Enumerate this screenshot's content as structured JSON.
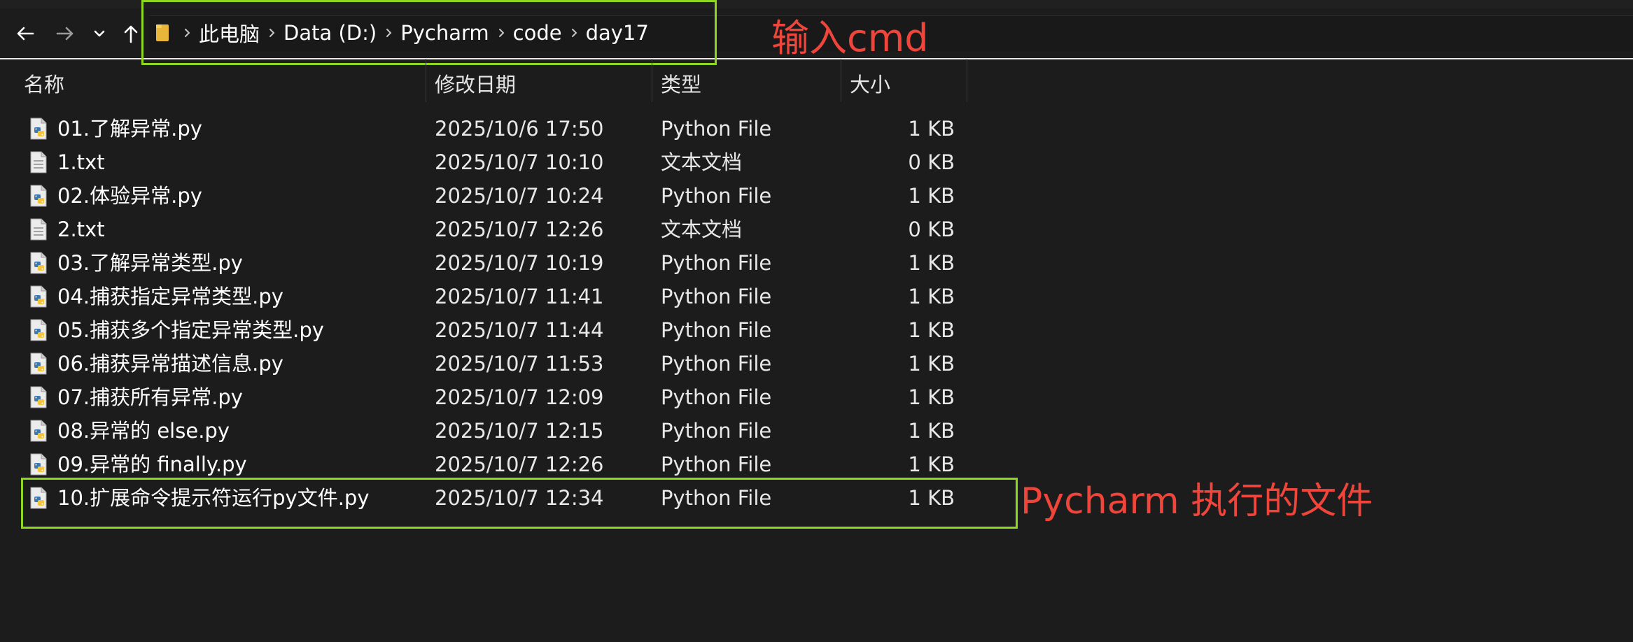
{
  "navigation": {
    "back_icon": "arrow-left-icon",
    "forward_icon": "arrow-right-icon",
    "recent_icon": "chevron-down-icon",
    "up_icon": "arrow-up-icon"
  },
  "breadcrumb": {
    "root_icon": "folder-icon",
    "items": [
      "此电脑",
      "Data (D:)",
      "Pycharm",
      "code",
      "day17"
    ]
  },
  "columns": {
    "name": "名称",
    "modified": "修改日期",
    "type": "类型",
    "size": "大小"
  },
  "files": [
    {
      "name": "01.了解异常.py",
      "modified": "2025/10/6 17:50",
      "type": "Python File",
      "size": "1 KB",
      "icon": "python-file-icon"
    },
    {
      "name": "1.txt",
      "modified": "2025/10/7 10:10",
      "type": "文本文档",
      "size": "0 KB",
      "icon": "text-file-icon"
    },
    {
      "name": "02.体验异常.py",
      "modified": "2025/10/7 10:24",
      "type": "Python File",
      "size": "1 KB",
      "icon": "python-file-icon"
    },
    {
      "name": "2.txt",
      "modified": "2025/10/7 12:26",
      "type": "文本文档",
      "size": "0 KB",
      "icon": "text-file-icon"
    },
    {
      "name": "03.了解异常类型.py",
      "modified": "2025/10/7 10:19",
      "type": "Python File",
      "size": "1 KB",
      "icon": "python-file-icon"
    },
    {
      "name": "04.捕获指定异常类型.py",
      "modified": "2025/10/7 11:41",
      "type": "Python File",
      "size": "1 KB",
      "icon": "python-file-icon"
    },
    {
      "name": "05.捕获多个指定异常类型.py",
      "modified": "2025/10/7 11:44",
      "type": "Python File",
      "size": "1 KB",
      "icon": "python-file-icon"
    },
    {
      "name": "06.捕获异常描述信息.py",
      "modified": "2025/10/7 11:53",
      "type": "Python File",
      "size": "1 KB",
      "icon": "python-file-icon"
    },
    {
      "name": "07.捕获所有异常.py",
      "modified": "2025/10/7 12:09",
      "type": "Python File",
      "size": "1 KB",
      "icon": "python-file-icon"
    },
    {
      "name": "08.异常的 else.py",
      "modified": "2025/10/7 12:15",
      "type": "Python File",
      "size": "1 KB",
      "icon": "python-file-icon"
    },
    {
      "name": "09.异常的 finally.py",
      "modified": "2025/10/7 12:26",
      "type": "Python File",
      "size": "1 KB",
      "icon": "python-file-icon"
    },
    {
      "name": "10.扩展命令提示符运行py文件.py",
      "modified": "2025/10/7 12:34",
      "type": "Python File",
      "size": "1 KB",
      "icon": "python-file-icon"
    }
  ],
  "annotations": {
    "address_note": "输入cmd",
    "file_note": "Pycharm 执行的文件",
    "note_color": "#f0453a",
    "box_color": "#8ed61f"
  }
}
